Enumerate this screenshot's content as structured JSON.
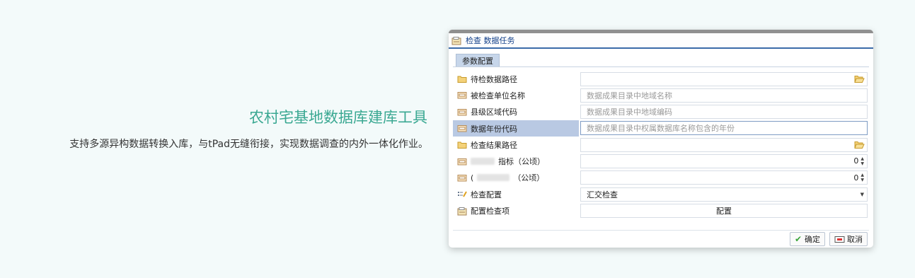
{
  "hero": {
    "title": "农村宅基地数据库建库工具",
    "description": "支持多源异构数据转换入库，与tPad无缝衔接，实现数据调查的内外一体化作业。"
  },
  "dialog": {
    "title": "检查 数据任务",
    "tab": "参数配置",
    "rows": [
      {
        "label": "待检数据路径",
        "value": "",
        "placeholder": ""
      },
      {
        "label": "被检查单位名称",
        "value": "",
        "placeholder": "数据成果目录中地域名称"
      },
      {
        "label": "县级区域代码",
        "value": "",
        "placeholder": "数据成果目录中地域编码"
      },
      {
        "label": "数据年份代码",
        "value": "",
        "placeholder": "数据成果目录中权属数据库名称包含的年份"
      },
      {
        "label": "检查结果路径",
        "value": "",
        "placeholder": ""
      },
      {
        "label": "指标（公顷）",
        "value": "0"
      },
      {
        "label_prefix": "(",
        "label": "（公顷）",
        "value": "0"
      },
      {
        "label": "检查配置",
        "value": "汇交检查"
      },
      {
        "label": "配置检查项",
        "button": "配置"
      }
    ],
    "ok_label": "确定",
    "cancel_label": "取消"
  },
  "colors": {
    "accent_teal": "#3aa892",
    "title_blue": "#15428b",
    "selected_row": "#b9c9e3",
    "ok_green": "#3aa53a"
  }
}
